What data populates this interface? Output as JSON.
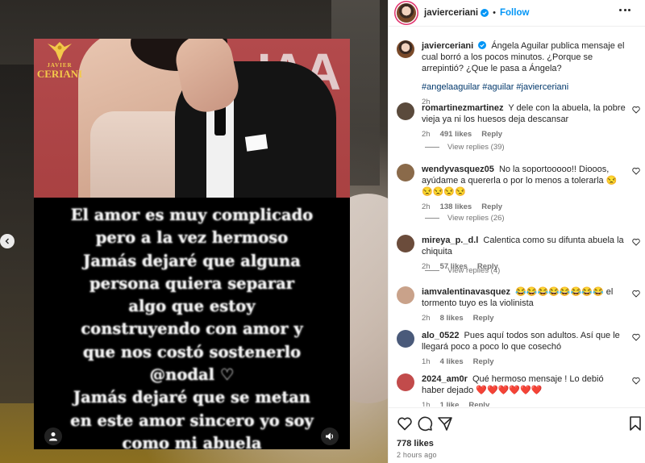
{
  "post": {
    "username": "javierceriani",
    "follow_label": "Follow",
    "separator": "•",
    "caption": "Ángela Aguilar publica mensaje el cual borró a los pocos minutos. ¿Porque se arrepintió? ¿Que le pasa a Ángela?",
    "hashtags": "#angelaaguilar #aguilar #javierceriani",
    "caption_time": "2h",
    "likes": "778 likes",
    "time_ago": "2 hours ago"
  },
  "media": {
    "logo_small": "JAVIER",
    "logo_big": "CERIANI",
    "quote_lines": [
      "El amor es muy complicado",
      "pero a la vez hermoso",
      "Jamás dejaré que alguna",
      "persona quiera separar",
      "algo que estoy",
      "construyendo con amor y",
      "que nos costó sostenerlo",
      "@nodal ♡",
      "Jamás dejaré que se metan",
      "en este amor sincero yo soy",
      "como mi abuela"
    ],
    "colors": {
      "logo_gold": "#f3c94a",
      "backdrop_red": "#b34a4c"
    }
  },
  "comments": [
    {
      "user": "romartinezmartinez",
      "text": "Y dele con la abuela, la pobre vieja ya ni los huesos deja descansar",
      "time": "2h",
      "likes": "491 likes",
      "reply": "Reply",
      "view_replies": "View replies (39)",
      "avatar_color": "#5a4a3c"
    },
    {
      "user": "wendyvasquez05",
      "text": "No la soportooooo!! Diooos, ayúdame a quererla o por lo menos a tolerarla 😒😒😒😒😒",
      "time": "2h",
      "likes": "138 likes",
      "reply": "Reply",
      "view_replies": "View replies (26)",
      "avatar_color": "#8a6a4a"
    },
    {
      "user": "mireya_p._d.l",
      "text": "Calentica como su difunta abuela la chiquita",
      "time": "2h",
      "likes": "57 likes",
      "reply": "Reply",
      "view_replies": "View replies (4)",
      "avatar_color": "#6b4c3b"
    },
    {
      "user": "iamvalentinavasquez",
      "text": "😂😂😂😂😂😂😂😂 el tormento tuyo es la violinista",
      "time": "2h",
      "likes": "8 likes",
      "reply": "Reply",
      "view_replies": "",
      "avatar_color": "#c9a28a"
    },
    {
      "user": "alo_0522",
      "text": "Pues aquí todos son adultos. Así que le llegará poco a poco lo que cosechó",
      "time": "1h",
      "likes": "4 likes",
      "reply": "Reply",
      "view_replies": "",
      "avatar_color": "#4a5a7a"
    },
    {
      "user": "2024_am0r",
      "text": "Qué hermoso mensaje ! Lo debió haber dejado ❤️❤️❤️❤️❤️❤️",
      "time": "1h",
      "likes": "1 like",
      "reply": "Reply",
      "view_replies": "",
      "avatar_color": "#c24b4b"
    }
  ],
  "icons": [
    "verified-icon",
    "more-icon",
    "heart-icon",
    "comment-icon",
    "share-icon",
    "bookmark-icon",
    "user-icon",
    "sound-icon",
    "prev-icon"
  ],
  "accent": {
    "follow_blue": "#0095f6",
    "hashtag": "#00376b",
    "muted": "#737373"
  }
}
